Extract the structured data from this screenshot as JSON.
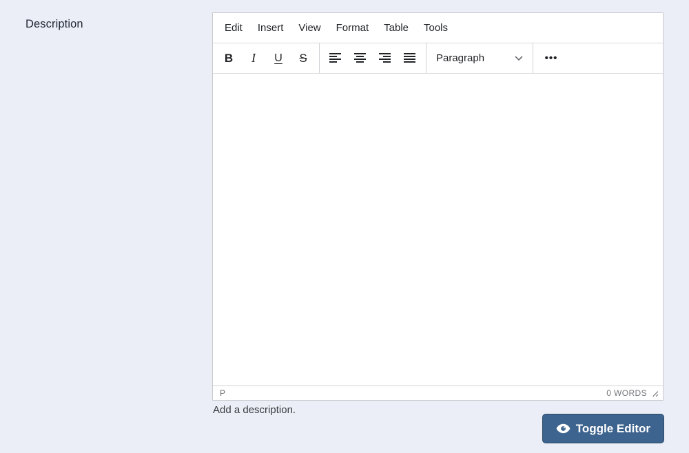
{
  "page": {
    "background": "#ebeef6"
  },
  "field": {
    "label": "Description",
    "help_text": "Add a description."
  },
  "editor": {
    "menu": [
      "Edit",
      "Insert",
      "View",
      "Format",
      "Table",
      "Tools"
    ],
    "toolbar": {
      "bold": "B",
      "italic": "I",
      "underline": "U",
      "strikethrough": "S",
      "align_icons": [
        "align-left",
        "align-center",
        "align-right",
        "align-justify"
      ],
      "format_select": "Paragraph",
      "more": "•••"
    },
    "statusbar": {
      "element_path": "P",
      "word_count": "0 WORDS"
    }
  },
  "actions": {
    "toggle_editor_label": "Toggle Editor",
    "toggle_editor_icon": "eye-icon"
  },
  "colors": {
    "button_background": "#3d648f",
    "button_border": "#2c4a68",
    "editor_border": "#c9cace",
    "text": "#222326"
  }
}
